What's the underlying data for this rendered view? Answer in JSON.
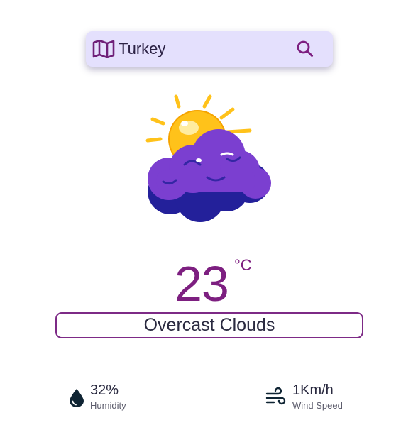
{
  "search": {
    "value": "Turkey",
    "icon": "map-icon",
    "button_icon": "search-icon"
  },
  "weather": {
    "icon": "sun-behind-cloud-icon",
    "temperature": "23",
    "unit": "°C",
    "description": "Overcast Clouds"
  },
  "stats": {
    "humidity": {
      "value": "32%",
      "label": "Humidity",
      "icon": "water-drop-icon"
    },
    "wind": {
      "value": "1Km/h",
      "label": "Wind Speed",
      "icon": "wind-icon"
    }
  },
  "colors": {
    "accent": "#7d1f80",
    "search_background": "#e4e0fd",
    "cloud": "#7b3fd0",
    "cloud_shadow": "#23209a",
    "sun": "#ffc21a"
  }
}
